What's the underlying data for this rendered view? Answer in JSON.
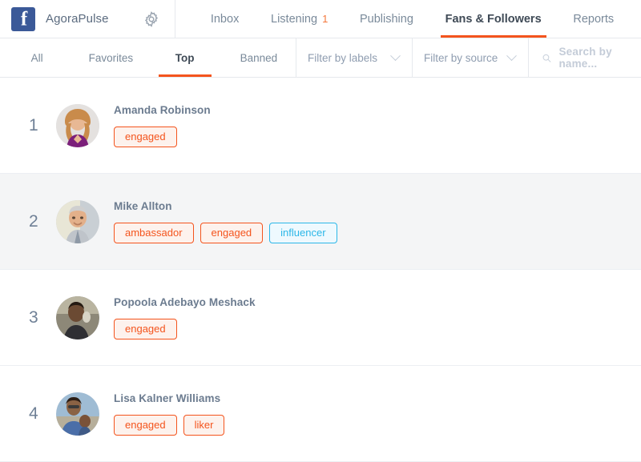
{
  "topbar": {
    "brand_name": "AgoraPulse",
    "logo_glyph": "f",
    "settings_icon": "gear-icon",
    "nav": [
      {
        "label": "Inbox",
        "badge": "",
        "active": false
      },
      {
        "label": "Listening",
        "badge": "1",
        "active": false
      },
      {
        "label": "Publishing",
        "badge": "",
        "active": false
      },
      {
        "label": "Fans & Followers",
        "badge": "",
        "active": true
      },
      {
        "label": "Reports",
        "badge": "",
        "active": false
      }
    ]
  },
  "filterbar": {
    "subtabs": [
      {
        "label": "All",
        "active": false
      },
      {
        "label": "Favorites",
        "active": false
      },
      {
        "label": "Top",
        "active": true
      },
      {
        "label": "Banned",
        "active": false
      }
    ],
    "labels_filter": {
      "value": "Filter by labels",
      "icon": "chevron-down-icon"
    },
    "source_filter": {
      "value": "Filter by source",
      "icon": "chevron-down-icon"
    },
    "search": {
      "placeholder": "Search by name...",
      "value": "",
      "icon": "search-icon"
    }
  },
  "colors": {
    "accent_orange": "#f4541d",
    "accent_blue": "#2bb7e8",
    "facebook_blue": "#3b5998",
    "row_highlight": "#f4f5f6",
    "text_muted": "#7a8a9a"
  },
  "fans": [
    {
      "rank": "1",
      "name": "Amanda Robinson",
      "highlight": false,
      "labels": [
        {
          "text": "engaged",
          "color": "orange"
        }
      ]
    },
    {
      "rank": "2",
      "name": "Mike Allton",
      "highlight": true,
      "labels": [
        {
          "text": "ambassador",
          "color": "orange"
        },
        {
          "text": "engaged",
          "color": "orange"
        },
        {
          "text": "influencer",
          "color": "blue"
        }
      ]
    },
    {
      "rank": "3",
      "name": "Popoola Adebayo Meshack",
      "highlight": false,
      "labels": [
        {
          "text": "engaged",
          "color": "orange"
        }
      ]
    },
    {
      "rank": "4",
      "name": "Lisa Kalner Williams",
      "highlight": false,
      "labels": [
        {
          "text": "engaged",
          "color": "orange"
        },
        {
          "text": "liker",
          "color": "orange"
        }
      ]
    }
  ]
}
